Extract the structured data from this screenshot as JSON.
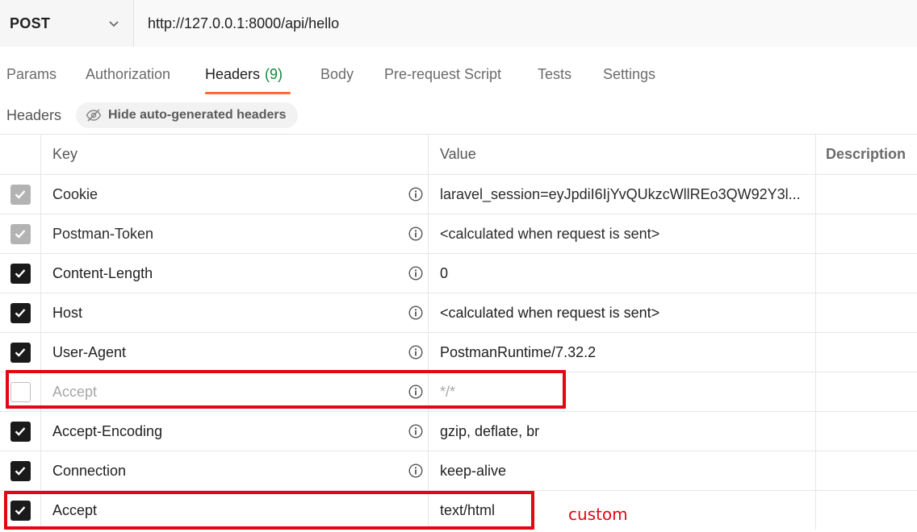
{
  "request": {
    "method": "POST",
    "url": "http://127.0.0.1:8000/api/hello"
  },
  "tabs": [
    {
      "label": "Params"
    },
    {
      "label": "Authorization"
    },
    {
      "label": "Headers",
      "count": "(9)",
      "active": true
    },
    {
      "label": "Body"
    },
    {
      "label": "Pre-request Script"
    },
    {
      "label": "Tests"
    },
    {
      "label": "Settings"
    }
  ],
  "headers_section": {
    "title": "Headers",
    "hide_button_label": "Hide auto-generated headers"
  },
  "table": {
    "columns": {
      "key": "Key",
      "value": "Value",
      "description": "Description"
    },
    "rows": [
      {
        "checked": "auto",
        "key": "Cookie",
        "value": "laravel_session=eyJpdiI6IjYvQUkzcWllREo3QW92Y3l...",
        "info": true
      },
      {
        "checked": "auto",
        "key": "Postman-Token",
        "value": "<calculated when request is sent>",
        "info": true
      },
      {
        "checked": "on",
        "key": "Content-Length",
        "value": "0",
        "info": true
      },
      {
        "checked": "on",
        "key": "Host",
        "value": "<calculated when request is sent>",
        "info": true
      },
      {
        "checked": "on",
        "key": "User-Agent",
        "value": "PostmanRuntime/7.32.2",
        "info": true
      },
      {
        "checked": "off",
        "key": "Accept",
        "value": "*/*",
        "info": true
      },
      {
        "checked": "on",
        "key": "Accept-Encoding",
        "value": "gzip, deflate, br",
        "info": true
      },
      {
        "checked": "on",
        "key": "Connection",
        "value": "keep-alive",
        "info": true
      },
      {
        "checked": "on",
        "key": "Accept",
        "value": "text/html",
        "info": false
      }
    ]
  },
  "annotation": {
    "label": "custom",
    "color": "#e30613"
  },
  "colors": {
    "accent": "#ff6c37",
    "count": "#0f8a3a",
    "highlight": "#e30613"
  },
  "icons": {
    "method_dropdown": "chevron-down-icon",
    "hide_button": "eye-off-icon",
    "info": "info-icon",
    "check": "check-icon"
  }
}
